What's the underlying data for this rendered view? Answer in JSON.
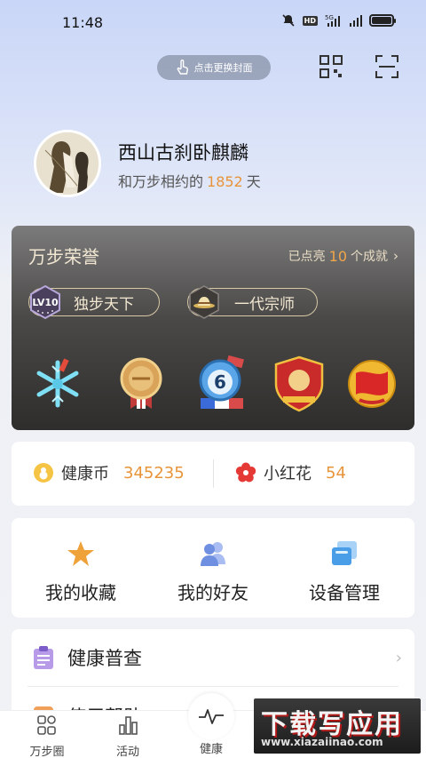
{
  "status_bar": {
    "time": "11:48",
    "icons": [
      "bell-off-icon",
      "hd-badge",
      "signal-5g-icon",
      "signal-bars-icon",
      "battery-icon"
    ],
    "hd": "HD",
    "net": "5G",
    "battery_level": 0.9
  },
  "header": {
    "cover_button_label": "点击更换封面"
  },
  "profile": {
    "name": "西山古刹卧麒麟",
    "sub_prefix": "和万步相约的",
    "days": "1852",
    "sub_suffix": "天"
  },
  "honor": {
    "title": "万步荣誉",
    "link_prefix": "已点亮",
    "count": "10",
    "link_suffix": "个成就",
    "titles": [
      {
        "badge": "LV10",
        "label": "独步天下"
      },
      {
        "badge": "hat",
        "label": "一代宗师"
      }
    ],
    "medals": [
      "snowflake-medal",
      "bronze-medal",
      "number-6-medal",
      "shield-medal",
      "red-flag-medal"
    ],
    "medal_number": "6"
  },
  "coins": {
    "health_coin_label": "健康币",
    "health_coin_value": "345235",
    "flower_label": "小红花",
    "flower_value": "54"
  },
  "actions": [
    {
      "label": "我的收藏",
      "icon": "star-icon"
    },
    {
      "label": "我的好友",
      "icon": "friends-icon"
    },
    {
      "label": "设备管理",
      "icon": "devices-icon"
    }
  ],
  "list": [
    {
      "label": "健康普查",
      "icon": "clipboard-icon"
    },
    {
      "label": "使用帮助",
      "icon": "help-icon"
    }
  ],
  "tabs": [
    {
      "label": "万步圈"
    },
    {
      "label": "活动"
    },
    {
      "label": "健康"
    }
  ],
  "watermark": {
    "big": "下载写应用",
    "small": "www.xiazaiinao.com"
  },
  "colors": {
    "accent": "#e8943a",
    "honor_bg": "#4a4948",
    "star": "#f0a23a",
    "friends": "#6f8fe0",
    "devices": "#4a9ee8"
  }
}
